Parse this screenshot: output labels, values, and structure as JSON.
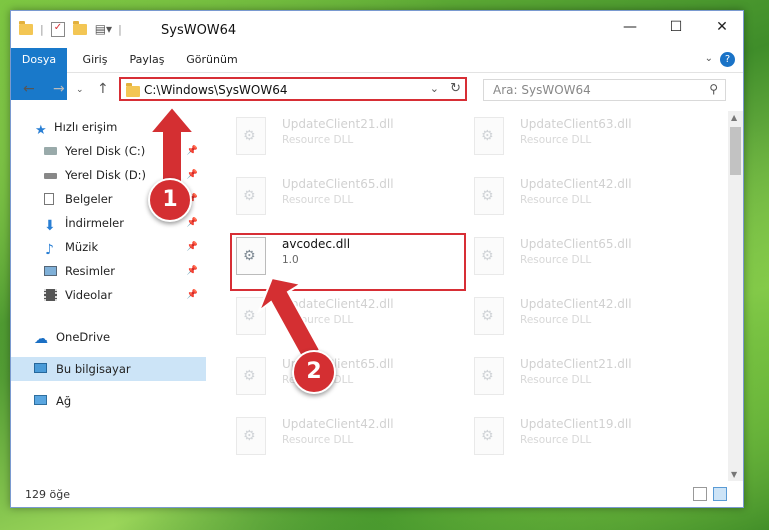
{
  "window": {
    "title": "SysWOW64"
  },
  "ribbon": {
    "tabs": [
      "Dosya",
      "Giriş",
      "Paylaş",
      "Görünüm"
    ]
  },
  "address": {
    "path": "C:\\Windows\\SysWOW64"
  },
  "search": {
    "placeholder": "Ara: SysWOW64"
  },
  "nav": {
    "items": [
      {
        "label": "Hızlı erişim",
        "icon": "star-icon"
      },
      {
        "label": "Yerel Disk (C:)",
        "icon": "drive-icon",
        "pinned": true
      },
      {
        "label": "Yerel Disk (D:)",
        "icon": "drive-icon",
        "pinned": true
      },
      {
        "label": "Belgeler",
        "icon": "documents-icon",
        "pinned": true
      },
      {
        "label": "İndirmeler",
        "icon": "download-icon",
        "pinned": true
      },
      {
        "label": "Müzik",
        "icon": "music-icon",
        "pinned": true
      },
      {
        "label": "Resimler",
        "icon": "pictures-icon",
        "pinned": true
      },
      {
        "label": "Videolar",
        "icon": "video-icon",
        "pinned": true
      },
      {
        "label": "OneDrive",
        "icon": "cloud-icon"
      },
      {
        "label": "Bu bilgisayar",
        "icon": "computer-icon",
        "selected": true
      },
      {
        "label": "Ağ",
        "icon": "network-icon"
      }
    ]
  },
  "files": [
    {
      "name": "UpdateClient21.dll",
      "type": "Resource DLL"
    },
    {
      "name": "UpdateClient63.dll",
      "type": "Resource DLL"
    },
    {
      "name": "UpdateClient65.dll",
      "type": "Resource DLL"
    },
    {
      "name": "UpdateClient42.dll",
      "type": "Resource DLL"
    },
    {
      "name": "avcodec.dll",
      "type": "1.0",
      "highlighted": true
    },
    {
      "name": "UpdateClient65.dll",
      "type": "Resource DLL"
    },
    {
      "name": "UpdateClient42.dll",
      "type": "Resource DLL"
    },
    {
      "name": "UpdateClient42.dll",
      "type": "Resource DLL"
    },
    {
      "name": "UpdateClient65.dll",
      "type": "Resource DLL"
    },
    {
      "name": "UpdateClient21.dll",
      "type": "Resource DLL"
    },
    {
      "name": "UpdateClient42.dll",
      "type": "Resource DLL"
    },
    {
      "name": "UpdateClient19.dll",
      "type": "Resource DLL"
    }
  ],
  "status": {
    "count": "129 öğe"
  },
  "annotations": {
    "step1": "1",
    "step2": "2",
    "color": "#d42f32"
  },
  "colors": {
    "accent": "#1979ca",
    "highlight": "#d72e35",
    "selected": "#cce4f7"
  }
}
